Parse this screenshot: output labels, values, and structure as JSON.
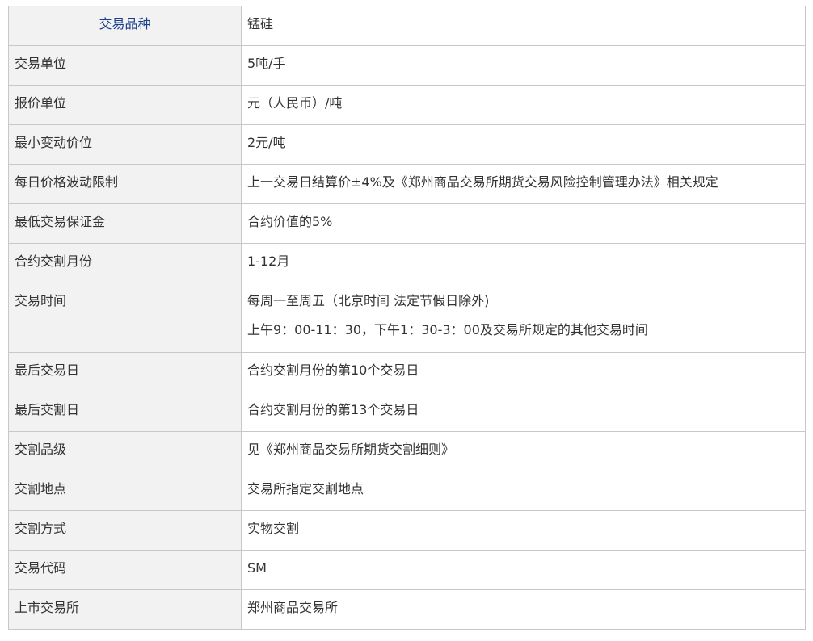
{
  "table": {
    "rows": [
      {
        "key": "交易品种",
        "value": "锰硅"
      },
      {
        "key": "交易单位",
        "value": "5吨/手"
      },
      {
        "key": "报价单位",
        "value": "元（人民币）/吨"
      },
      {
        "key": "最小变动价位",
        "value": "2元/吨"
      },
      {
        "key": "每日价格波动限制",
        "value": "上一交易日结算价±4%及《郑州商品交易所期货交易风险控制管理办法》相关规定"
      },
      {
        "key": "最低交易保证金",
        "value": "合约价值的5%"
      },
      {
        "key": "合约交割月份",
        "value": "1-12月"
      },
      {
        "key": "交易时间",
        "value": "每周一至周五（北京时间 法定节假日除外)",
        "value2": "上午9：00-11：30，下午1：30-3：00及交易所规定的其他交易时间"
      },
      {
        "key": "最后交易日",
        "value": "合约交割月份的第10个交易日"
      },
      {
        "key": "最后交割日",
        "value": "合约交割月份的第13个交易日"
      },
      {
        "key": "交割品级",
        "value": "见《郑州商品交易所期货交割细则》"
      },
      {
        "key": "交割地点",
        "value": "交易所指定交割地点"
      },
      {
        "key": "交割方式",
        "value": "实物交割"
      },
      {
        "key": "交易代码",
        "value": "SM"
      },
      {
        "key": "上市交易所",
        "value": "郑州商品交易所"
      }
    ]
  }
}
